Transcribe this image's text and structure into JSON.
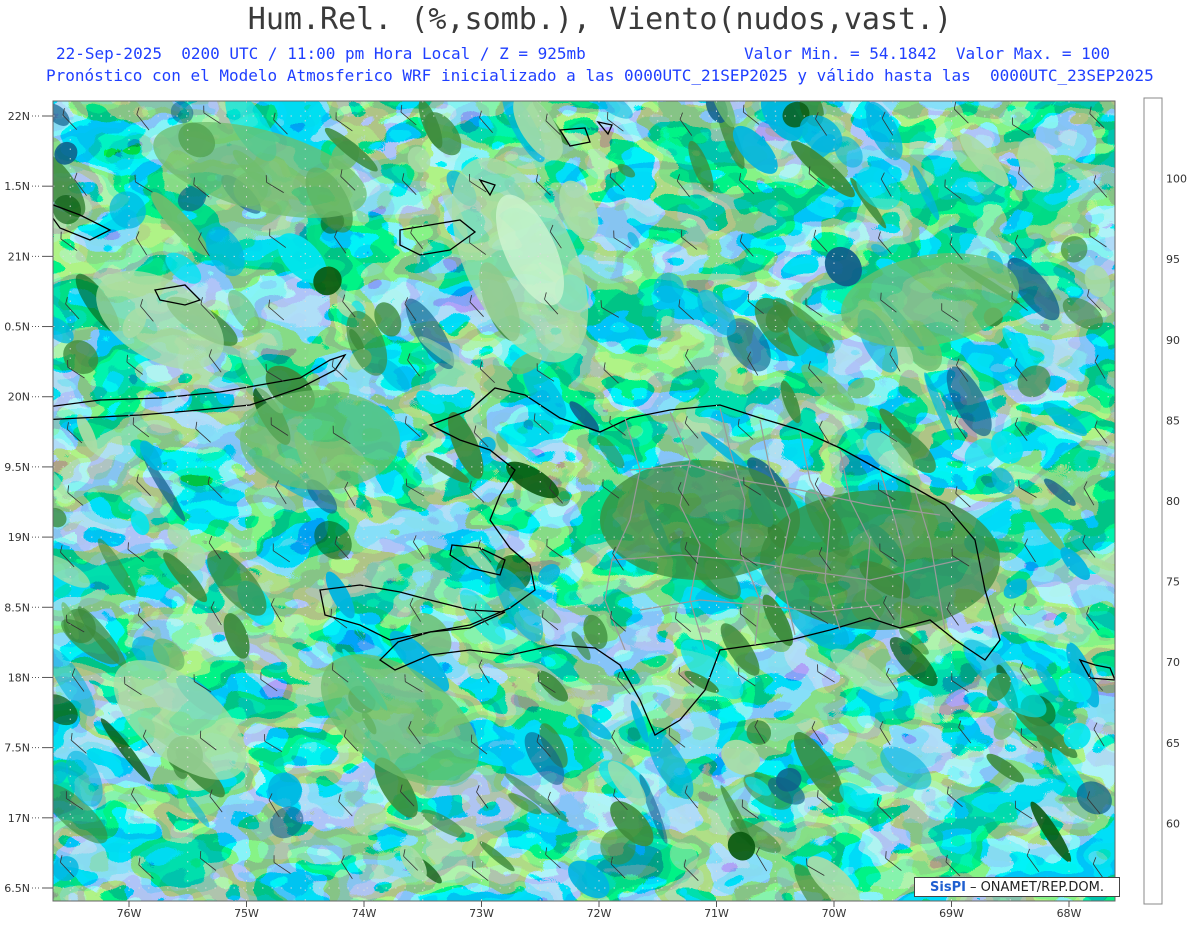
{
  "header": {
    "title": "Hum.Rel. (%,somb.), Viento(nudos,vast.)",
    "line1_left": "22-Sep-2025  0200 UTC / 11:00 pm Hora Local / Z = 925mb",
    "line1_right": "Valor Min. = 54.1842  Valor Max. = 100",
    "line2": "Pronóstico con el Modelo Atmosferico WRF inicializado a las 0000UTC_21SEP2025 y válido hasta las  0000UTC_23SEP2025"
  },
  "map": {
    "lat_labels": [
      "22N",
      "1.5N",
      "21N",
      "0.5N",
      "20N",
      "9.5N",
      "19N",
      "8.5N",
      "18N",
      "7.5N",
      "17N",
      "6.5N"
    ],
    "lon_labels": [
      "76W",
      "75W",
      "74W",
      "73W",
      "72W",
      "71W",
      "70W",
      "69W",
      "68W"
    ],
    "lat_range": [
      16.5,
      22.0
    ],
    "lon_range": [
      -76.6,
      -67.6
    ],
    "colors": {
      "rh_60": "#e8e8e8",
      "rh_65": "#d2f5d2",
      "rh_70": "#a9dda6",
      "rh_75": "#6fbd6c",
      "rh_80": "#3d8b3c",
      "rh_85": "#0a5a10",
      "rh_90": "#0f5f8a",
      "rh_95": "#00b5e0",
      "rh_100": "#00e6f0",
      "rh_max": "#9bf4f6",
      "coast": "#000000",
      "provinces": "#9a9a9a"
    }
  },
  "colorbar": {
    "labels": [
      "100",
      "95",
      "90",
      "85",
      "80",
      "75",
      "70",
      "65",
      "60"
    ]
  },
  "credit": {
    "logo": "SisPI",
    "text": "– ONAMET/REP.DOM."
  }
}
